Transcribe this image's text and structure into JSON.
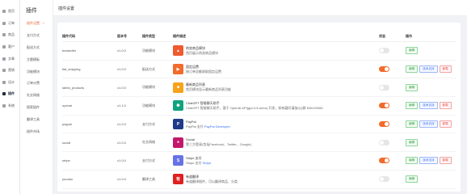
{
  "sidebar": {
    "items": [
      {
        "label": "首页",
        "active": false
      },
      {
        "label": "订单",
        "active": false
      },
      {
        "label": "商品",
        "active": false
      },
      {
        "label": "客户",
        "active": false
      },
      {
        "label": "文章",
        "active": false
      },
      {
        "label": "营销",
        "active": false
      },
      {
        "label": "设计",
        "active": false
      },
      {
        "label": "插件",
        "active": true
      },
      {
        "label": "系统",
        "active": false
      }
    ]
  },
  "submenu": {
    "title": "插件",
    "items": [
      {
        "label": "插件设置",
        "active": true
      },
      {
        "label": "支付方式",
        "active": false
      },
      {
        "label": "配送方式",
        "active": false
      },
      {
        "label": "主题模板",
        "active": false
      },
      {
        "label": "功能模块",
        "active": false
      },
      {
        "label": "订单计费",
        "active": false
      },
      {
        "label": "社交网络",
        "active": false
      },
      {
        "label": "搜索插件",
        "active": false
      },
      {
        "label": "翻译工具",
        "active": false
      },
      {
        "label": "插件市场",
        "active": false
      }
    ]
  },
  "page": {
    "title": "插件设置"
  },
  "table": {
    "headers": [
      "插件代码",
      "版本号",
      "插件类型",
      "插件描述",
      "状态",
      "操作"
    ],
    "rows": [
      {
        "code": "bestseller",
        "version": "v1.0.0",
        "type": "功能模块",
        "name": "热卖商品模块",
        "sub": "首页展示热卖商品模块",
        "link": "",
        "icon": "flame-icon",
        "color": "#ef5a2f",
        "enabled": false,
        "buttons": [
          "编辑"
        ]
      },
      {
        "code": "flat_shipping",
        "version": "v1.0.0",
        "type": "配送方式",
        "name": "固定运费",
        "sub": "按订单总额收取固定运费",
        "link": "",
        "icon": "truck-icon",
        "color": "#f26b2c",
        "enabled": true,
        "buttons": [
          "编辑",
          "技术支持",
          "卸载"
        ]
      },
      {
        "code": "latest_products",
        "version": "v1.0.0",
        "type": "功能模块",
        "name": "最新商品列表",
        "sub": "首页模块显示最新商品列表功能",
        "link": "",
        "icon": "bag-icon",
        "color": "#f7a21b",
        "enabled": false,
        "buttons": [
          "编辑"
        ]
      },
      {
        "code": "openai",
        "version": "v1.1.0",
        "type": "功能模块",
        "name": "ChatGPT 智能聊天助手",
        "sub": "ChatGPT 智能聊天助手，基于 OpenAI API(gpt-3.5-turbo) 开发，如有疑问请加QQ群 639109380",
        "link": "",
        "icon": "openai-icon",
        "color": "#10a37f",
        "enabled": true,
        "buttons": [
          "编辑",
          "技术支持",
          "卸载"
        ]
      },
      {
        "code": "paypal",
        "version": "v1.0.0",
        "type": "支付方式",
        "name": "PayPal",
        "sub": "PayPal 支付 ",
        "link": "PayPal Developer",
        "icon": "paypal-icon",
        "color": "#1e3a8a",
        "enabled": true,
        "buttons": [
          "编辑",
          "技术支持",
          "卸载"
        ]
      },
      {
        "code": "social",
        "version": "v1.0.0",
        "type": "社交网络",
        "name": "Social",
        "sub": "第三方登录(包括Facebook、Twitter、Google)",
        "link": "",
        "icon": "social-icon",
        "color": "#c2186b",
        "enabled": false,
        "buttons": [
          "编辑"
        ]
      },
      {
        "code": "stripe",
        "version": "v1.0.0",
        "type": "支付方式",
        "name": "Stripe 支付",
        "sub": "Stripe 支付 ",
        "link": "Stripe",
        "icon": "stripe-icon",
        "color": "#6772e5",
        "enabled": true,
        "buttons": [
          "编辑",
          "技术支持",
          "卸载"
        ]
      },
      {
        "code": "youdao",
        "version": "v1.0.0",
        "type": "翻译工具",
        "name": "有道翻译",
        "sub": "有道翻译插件，可以翻译商品、分类",
        "link": "",
        "icon": "youdao-icon",
        "color": "#e02020",
        "enabled": false,
        "buttons": [
          "编辑"
        ]
      }
    ]
  }
}
